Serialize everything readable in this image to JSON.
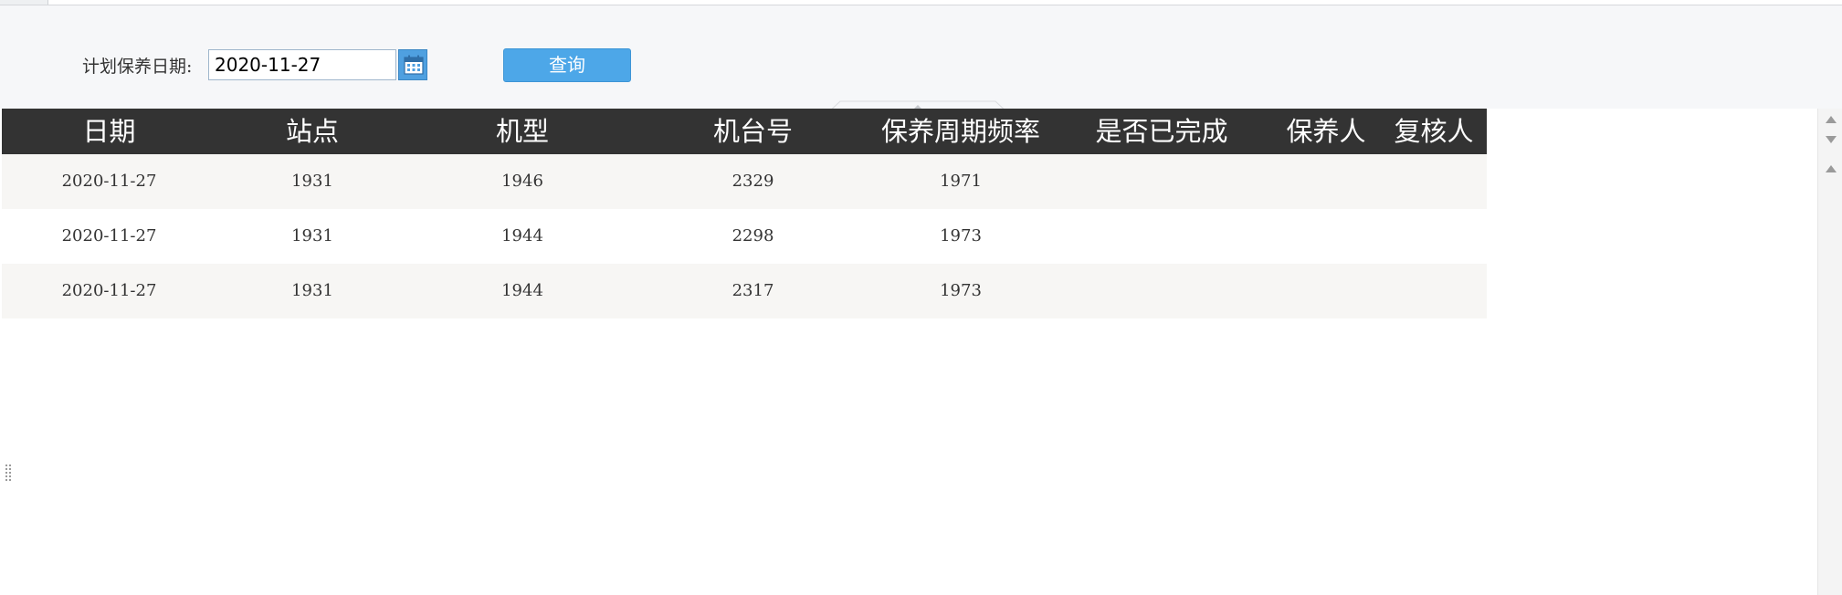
{
  "query": {
    "date_label": "计划保养日期:",
    "date_value": "2020-11-27",
    "query_button": "查询",
    "calendar_icon": "calendar-icon"
  },
  "table": {
    "columns": [
      "日期",
      "站点",
      "机型",
      "机台号",
      "保养周期频率",
      "是否已完成",
      "保养人",
      "复核人"
    ],
    "rows": [
      [
        "2020-11-27",
        "1931",
        "1946",
        "2329",
        "1971",
        "",
        "",
        ""
      ],
      [
        "2020-11-27",
        "1931",
        "1944",
        "2298",
        "1973",
        "",
        "",
        ""
      ],
      [
        "2020-11-27",
        "1931",
        "1944",
        "2317",
        "1973",
        "",
        "",
        ""
      ]
    ]
  },
  "colors": {
    "header_bg": "#333333",
    "button_blue": "#4da7e8",
    "row_alt": "#f7f6f4"
  }
}
